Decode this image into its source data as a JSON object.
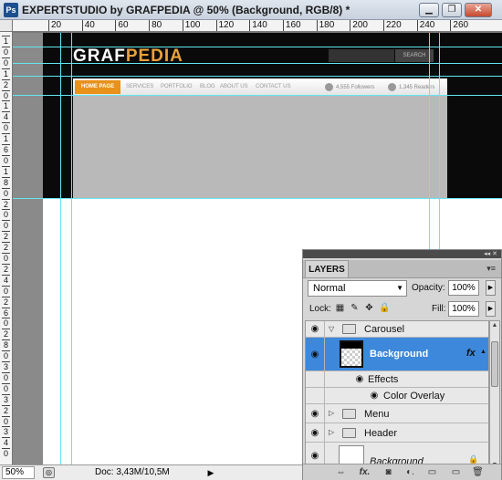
{
  "window": {
    "app_icon": "Ps",
    "title": "EXPERTSTUDIO by GRAFPEDIA @ 50% (Background, RGB/8) *",
    "controls": {
      "minimize": "▁",
      "maximize": "❐",
      "close": "✕"
    }
  },
  "ruler_top": [
    "20",
    "40",
    "60",
    "80",
    "100",
    "120",
    "140",
    "160",
    "180",
    "200",
    "220",
    "240",
    "260"
  ],
  "ruler_left": [
    "1",
    "0",
    "0",
    "1",
    "2",
    "0",
    "1",
    "4",
    "0",
    "1",
    "6",
    "0",
    "1",
    "8",
    "0",
    "2",
    "0",
    "0",
    "2",
    "2",
    "0",
    "2",
    "4",
    "0",
    "2",
    "6",
    "0",
    "2",
    "8",
    "0",
    "3",
    "0",
    "0",
    "3",
    "2",
    "0",
    "3",
    "4",
    "0"
  ],
  "mockup": {
    "brand_white": "GRAF",
    "brand_accent": "PEDIA",
    "search_btn": "SEARCH",
    "nav_home": "HOME PAGE",
    "nav_links": [
      "SERVICES",
      "PORTFOLIO",
      "BLOG",
      "ABOUT US",
      "CONTACT US"
    ],
    "followers": "4,555 Followers",
    "readers": "1,345 Readers"
  },
  "status": {
    "zoom": "50%",
    "doc": "Doc: 3,43M/10,5M",
    "arrow": "▶"
  },
  "layers_panel": {
    "tab": "LAYERS",
    "collapse_icons": "◂◂ ✕",
    "menu_icon": "▾≡",
    "blend_mode": "Normal",
    "blend_arrow": "▼",
    "opacity_label": "Opacity:",
    "opacity_value": "100%",
    "lock_label": "Lock:",
    "fill_label": "Fill:",
    "fill_value": "100%",
    "step_arrow": "▶",
    "rows": {
      "carousel": "Carousel",
      "background": "Background",
      "fx": "fx",
      "effects": "Effects",
      "color_overlay": "Color Overlay",
      "menu": "Menu",
      "header": "Header",
      "background2": "Background"
    },
    "eye_icon": "◉",
    "expanded_tri": "▽",
    "collapsed_tri": "▷",
    "scroll_up": "▲",
    "scroll_down": "▼",
    "bottom_icons": [
      "⇔",
      "fx.",
      "◙",
      "◐.",
      "▭",
      "▭",
      "🗑"
    ]
  }
}
